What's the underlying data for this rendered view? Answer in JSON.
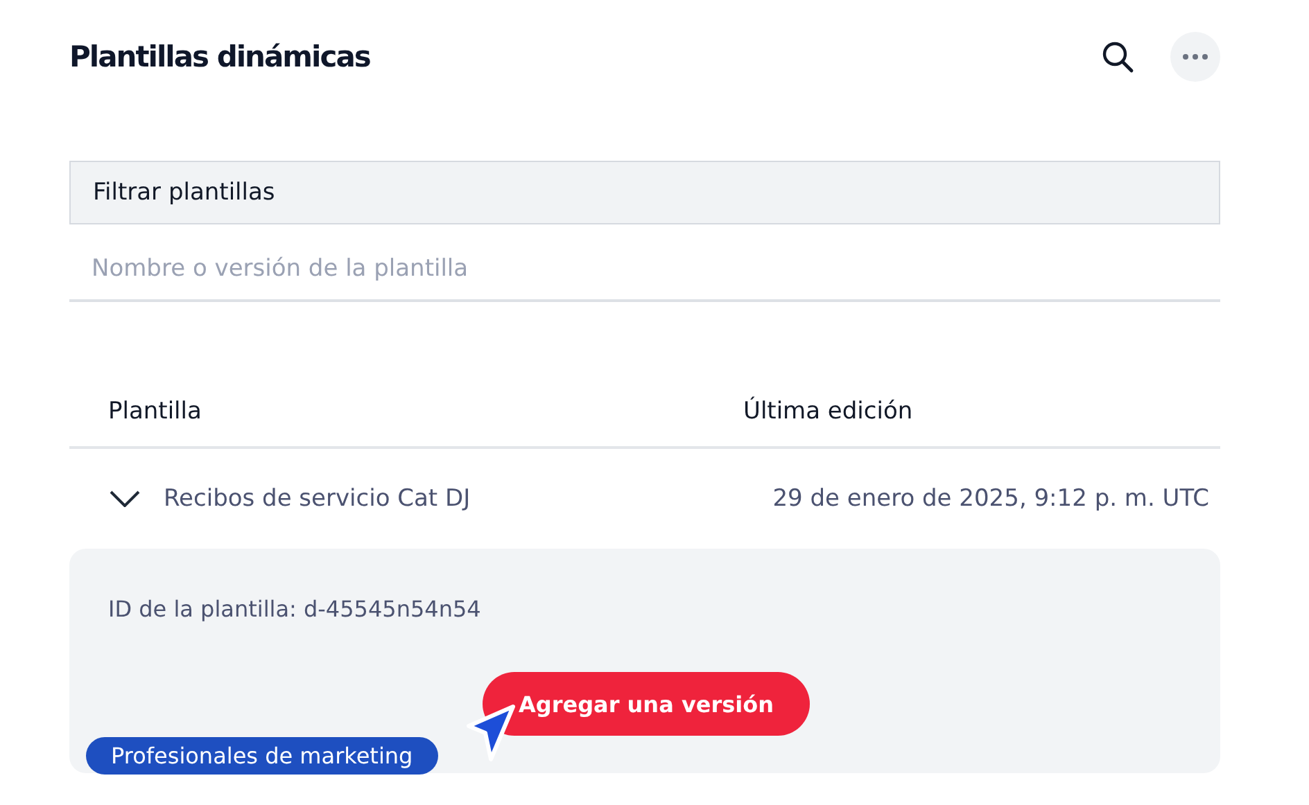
{
  "header": {
    "title": "Plantillas dinámicas"
  },
  "filter": {
    "label": "Filtrar plantillas",
    "placeholder": "Nombre o versión de la plantilla"
  },
  "table": {
    "columns": [
      "Plantilla",
      "Última edición"
    ],
    "rows": [
      {
        "name": "Recibos de servicio Cat DJ",
        "edited": "29 de enero de 2025, 9:12 p. m. UTC",
        "expanded": true,
        "detail": "ID de la plantilla: d-45545n54n54",
        "button": "Agregar una versión"
      }
    ]
  },
  "cursor_tag": "Profesionales de marketing"
}
